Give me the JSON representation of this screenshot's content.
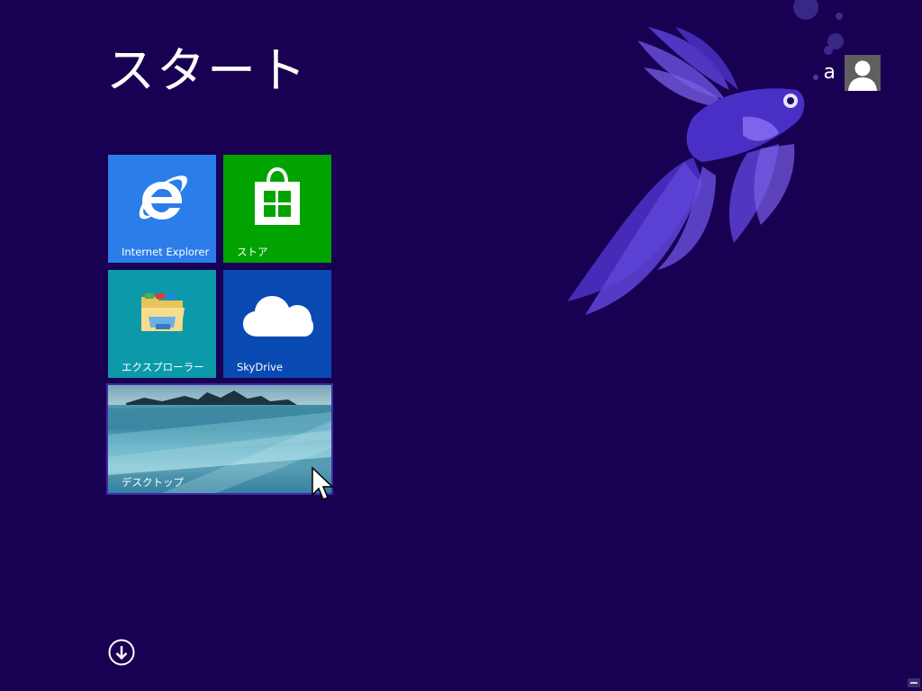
{
  "start": {
    "title": "スタート"
  },
  "user": {
    "name": "a",
    "avatar_icon": "user-silhouette-icon"
  },
  "tiles": [
    {
      "id": "ie",
      "label": "Internet Explorer",
      "icon": "internet-explorer-icon",
      "color": "#2b7de9"
    },
    {
      "id": "store",
      "label": "ストア",
      "icon": "store-bag-icon",
      "color": "#00a300"
    },
    {
      "id": "explorer",
      "label": "エクスプローラー",
      "icon": "folder-icon",
      "color": "#0c9aab"
    },
    {
      "id": "skydrive",
      "label": "SkyDrive",
      "icon": "cloud-icon",
      "color": "#094ab2"
    },
    {
      "id": "desktop",
      "label": "デスクトップ",
      "icon": "desktop-wallpaper",
      "color": "#3b8aa5"
    }
  ],
  "navigation": {
    "all_apps_icon": "arrow-down-circle-icon"
  },
  "colors": {
    "background": "#180052",
    "fish": "#5a3fd6"
  }
}
